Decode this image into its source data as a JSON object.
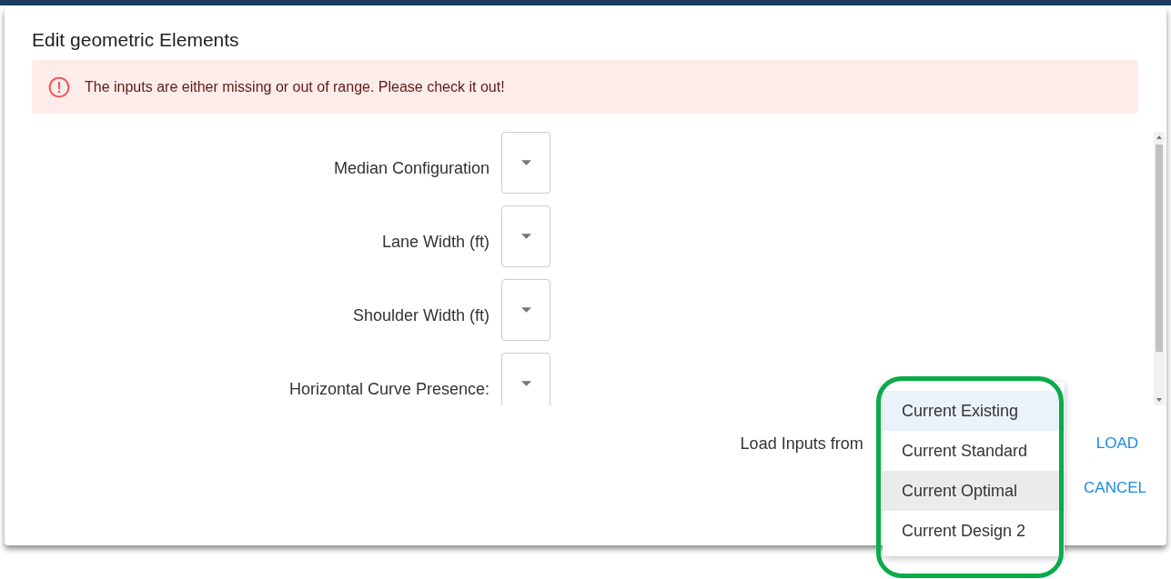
{
  "dialog": {
    "title": "Edit geometric Elements"
  },
  "alert": {
    "message": "The inputs are either missing or out of range. Please check it out!"
  },
  "fields": [
    {
      "label": "Median Configuration"
    },
    {
      "label": "Lane Width (ft)"
    },
    {
      "label": "Shoulder Width (ft)"
    },
    {
      "label": "Horizontal Curve Presence:"
    }
  ],
  "load": {
    "label": "Load Inputs from",
    "button": "LOAD"
  },
  "menu": {
    "highlighted": true,
    "items": [
      {
        "label": "Current Existing",
        "selected": true,
        "hovered": false
      },
      {
        "label": "Current Standard",
        "selected": false,
        "hovered": false
      },
      {
        "label": "Current Optimal",
        "selected": false,
        "hovered": true
      },
      {
        "label": "Current Design 2",
        "selected": false,
        "hovered": false
      }
    ]
  },
  "actions": {
    "cancel": "CANCEL"
  }
}
